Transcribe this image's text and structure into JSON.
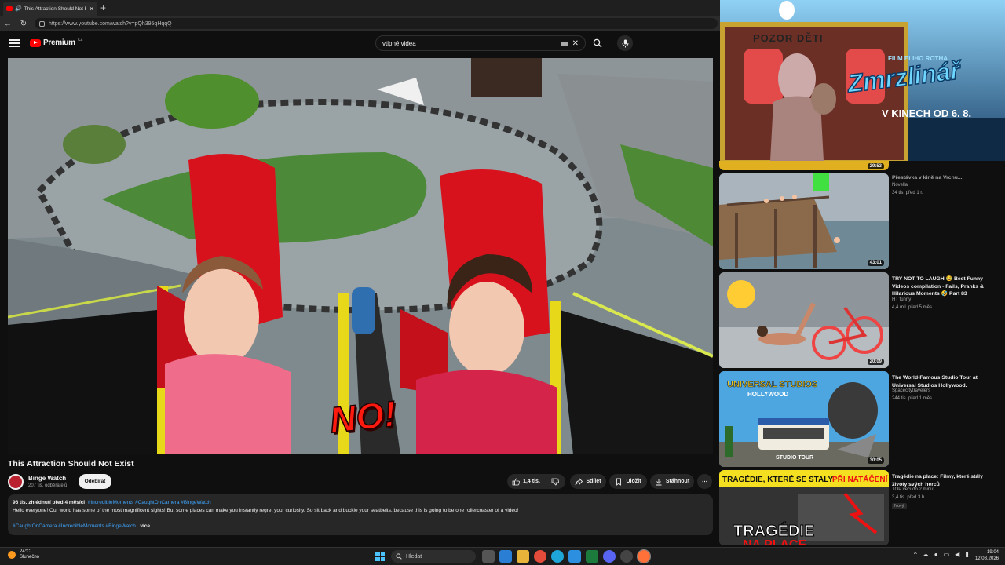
{
  "browser": {
    "tab_title": "This Attraction Should Not Exist",
    "new_tab": "+",
    "url": "https://www.youtube.com/watch?v=pQh395qHqqQ"
  },
  "header": {
    "logo": "Premium",
    "logo_country": "CZ",
    "search_value": "vtipné videa"
  },
  "video": {
    "overlay_text": "NO!",
    "title": "This Attraction Should Not Exist",
    "channel": "Binge Watch",
    "subscribers": "207 tis. odběratelů",
    "subscribe_label": "Odebírat",
    "likes": "1,4 tis.",
    "share_label": "Sdílet",
    "save_label": "Uložit",
    "download_label": "Stáhnout",
    "more_label": "⋯"
  },
  "description": {
    "meta": "96 tis. zhlédnutí  před 4 měsíci",
    "meta_tags": "#IncredibleMoments #CaughtOnCamera #BingeWatch",
    "text": "Hello everyone! Our world has some of the most magnificent sights! But some places can make you instantly regret your curiosity. So sit back and buckle your seatbelts, because this is going to be one rollercoaster of a video!",
    "tags": "#CaughtOnCamera #IncredibleMoments #BingeWatch",
    "more": "...více"
  },
  "ad": {
    "sign": "POZOR DĚTI",
    "film": "FILM ELIHO ROTHA",
    "title": "Zmrzlinář",
    "date": "V KINECH OD 6. 8."
  },
  "recommendations": [
    {
      "title": "Přestávka v kině na Vrchu...",
      "channel": "Novella",
      "views": "34 tis.  před 1 r.",
      "duration": "29:53"
    },
    {
      "title": "",
      "channel": "",
      "views": "",
      "duration": "43:01"
    },
    {
      "title": "TRY NOT TO LAUGH 😂 Best Funny Videos compilation - Fails, Pranks & Hilarious Moments 🤣 Part 83",
      "channel": "HT funny",
      "views": "4,4 mil.  před 5 měs.",
      "duration": "20:09"
    },
    {
      "title": "The World-Famous Studio Tour at Universal Studios Hollywood.",
      "channel": "Spacecitytravelers",
      "views": "244 tis.  před 1 měs.",
      "duration": "30:05"
    },
    {
      "title": "Tragédie na place: Filmy, které stály životy svých herců",
      "channel": "TOP veci do 2 minut",
      "views": "3,4 tis.  před 3 h",
      "duration": "",
      "badge": "Nový"
    }
  ],
  "thumb_text": {
    "universal": "UNIVERSAL STUDIOS",
    "hollywood": "HOLLYWOOD",
    "studio_tour": "STUDIO TOUR",
    "tragedie_top": "TRAGÉDIE, KTERÉ SE STALY",
    "tragedie_accent": "PŘI NATÁČENÍ",
    "tragedie_big": "TRAGÉDIE",
    "tragedie_big2": "NA PLACE"
  },
  "taskbar": {
    "temp": "24°C",
    "weather": "Slunečno",
    "search": "Hledat",
    "time": "19:04",
    "date": "12.08.2026"
  },
  "colors": {
    "accent": "#ff0000",
    "link": "#3ea6ff",
    "bg": "#0f0f0f"
  }
}
